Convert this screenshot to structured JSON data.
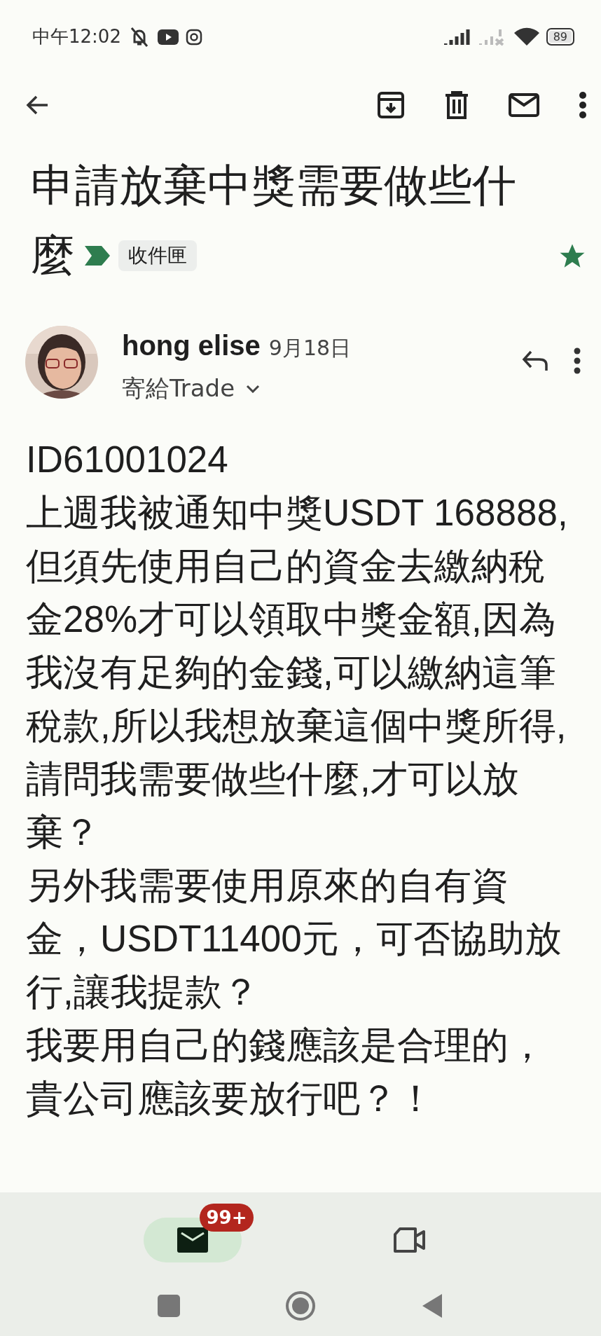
{
  "status_bar": {
    "time": "中午12:02",
    "battery": "89"
  },
  "subject": {
    "title_lines": [
      "申請放棄中獎需要做些什",
      "麼"
    ],
    "label": "收件匣",
    "starred": true,
    "important": true
  },
  "message": {
    "sender": "hong elise",
    "date": "9月18日",
    "recipient": "寄給Trade",
    "body": [
      "ID61001024",
      "上週我被通知中獎USDT 168888,但須先使用自己的資金去繳納稅金28%才可以領取中獎金額,因為我沒有足夠的金錢,可以繳納這筆稅款,所以我想放棄這個中獎所得,請問我需要做些什麼,才可以放棄？",
      "另外我需要使用原來的自有資金，USDT11400元，可否協助放行,讓我提款？",
      "我要用自己的錢應該是合理的，貴公司應該要放行吧？！"
    ]
  },
  "bottom_nav": [
    {
      "kind": "mail",
      "selected": true,
      "badge": "99+"
    },
    {
      "kind": "video",
      "selected": false
    }
  ]
}
